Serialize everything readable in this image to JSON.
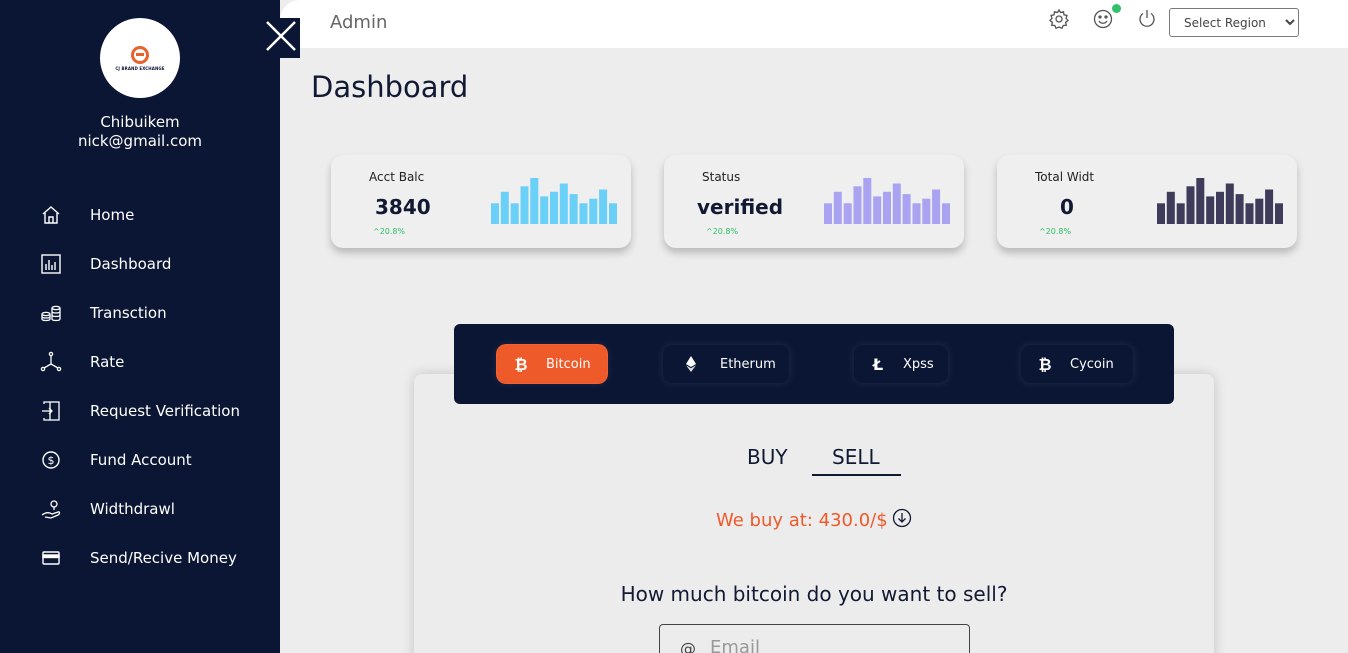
{
  "user": {
    "name": "Chibuikem",
    "email": "nick@gmail.com",
    "logo_text": "CJ BRAND EXCHANGE"
  },
  "sidebar": {
    "items": [
      {
        "label": "Home",
        "icon": "home-icon"
      },
      {
        "label": "Dashboard",
        "icon": "chart-icon"
      },
      {
        "label": "Transction",
        "icon": "coins-icon"
      },
      {
        "label": "Rate",
        "icon": "network-icon"
      },
      {
        "label": "Request Verification",
        "icon": "door-icon"
      },
      {
        "label": "Fund Account",
        "icon": "dollar-icon"
      },
      {
        "label": "Widthdrawl",
        "icon": "hand-icon"
      },
      {
        "label": "Send/Recive Money",
        "icon": "card-icon"
      }
    ]
  },
  "header": {
    "title": "Admin",
    "region_placeholder": "Select Region"
  },
  "page": {
    "title": "Dashboard"
  },
  "cards": [
    {
      "label": "Acct Balc",
      "value": "3840",
      "change": "^20.8%",
      "bar_color": "#6ad0f7",
      "bars": [
        0.45,
        0.7,
        0.45,
        0.82,
        1.0,
        0.6,
        0.7,
        0.88,
        0.65,
        0.45,
        0.55,
        0.75,
        0.45
      ]
    },
    {
      "label": "Status",
      "value": "verified",
      "change": "^20.8%",
      "bar_color": "#a9a3f2",
      "bars": [
        0.45,
        0.7,
        0.45,
        0.82,
        1.0,
        0.6,
        0.7,
        0.88,
        0.65,
        0.45,
        0.55,
        0.75,
        0.45
      ]
    },
    {
      "label": "Total Widt",
      "value": "0",
      "change": "^20.8%",
      "bar_color": "#3f3b5a",
      "bars": [
        0.45,
        0.7,
        0.45,
        0.82,
        1.0,
        0.6,
        0.7,
        0.88,
        0.65,
        0.45,
        0.55,
        0.75,
        0.45
      ]
    }
  ],
  "coins": [
    {
      "label": "Bitcoin",
      "active": true,
      "icon": "bitcoin-icon"
    },
    {
      "label": "Etherum",
      "active": false,
      "icon": "ethereum-icon"
    },
    {
      "label": "Xpss",
      "active": false,
      "icon": "litecoin-icon"
    },
    {
      "label": "Cycoin",
      "active": false,
      "icon": "bitcoin-icon"
    }
  ],
  "trade": {
    "tab_buy": "BUY",
    "tab_sell": "SELL",
    "active_tab": "SELL",
    "rate_text": "We buy at: 430.0/$",
    "question": "How much bitcoin do you want to sell?",
    "input_prefix": "@",
    "input_placeholder": "Email"
  },
  "colors": {
    "sidebar": "#0a1633",
    "accent": "#ef5a2a",
    "success": "#2ec26a"
  }
}
